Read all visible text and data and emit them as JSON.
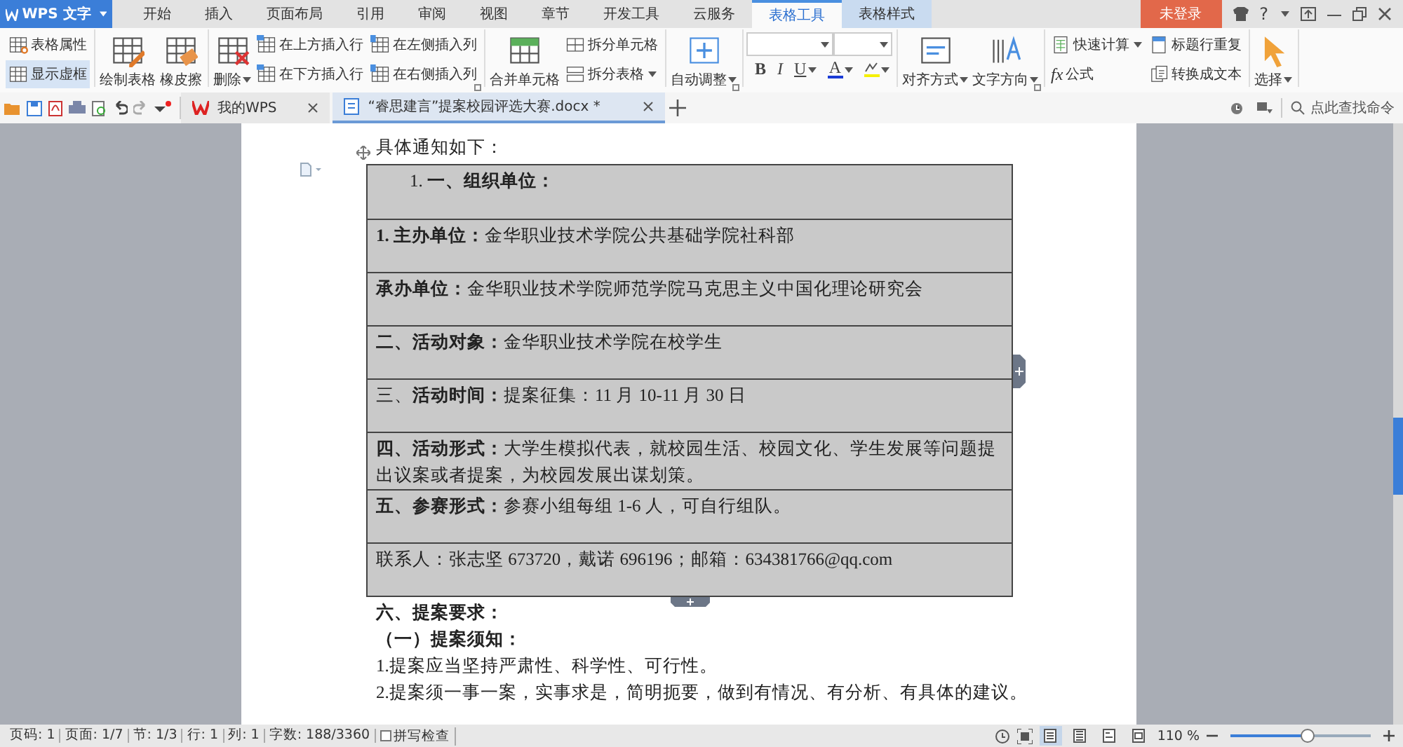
{
  "app_menu": {
    "label": "WPS 文字"
  },
  "menu_tabs": [
    {
      "label": "开始",
      "kind": "main",
      "selected": false
    },
    {
      "label": "插入",
      "kind": "main",
      "selected": false
    },
    {
      "label": "页面布局",
      "kind": "main",
      "selected": false
    },
    {
      "label": "引用",
      "kind": "main",
      "selected": false
    },
    {
      "label": "审阅",
      "kind": "main",
      "selected": false
    },
    {
      "label": "视图",
      "kind": "main",
      "selected": false
    },
    {
      "label": "章节",
      "kind": "main",
      "selected": false
    },
    {
      "label": "开发工具",
      "kind": "main",
      "selected": false
    },
    {
      "label": "云服务",
      "kind": "main",
      "selected": false
    },
    {
      "label": "表格工具",
      "kind": "contextual",
      "selected": true
    },
    {
      "label": "表格样式",
      "kind": "contextual",
      "selected": false
    }
  ],
  "login_button": "未登录",
  "help": "?",
  "ribbon_groups": [
    {
      "kind": "tools",
      "launcher": false,
      "items": [
        {
          "label": "表格属性",
          "kind": "small",
          "dropdown": false,
          "selected": false
        },
        {
          "label": "显示虚框",
          "kind": "small",
          "dropdown": false,
          "selected": true
        }
      ]
    },
    {
      "kind": "tools",
      "launcher": false,
      "items": [
        {
          "label": "绘制表格",
          "kind": "large",
          "dropdown": false
        },
        {
          "label": "橡皮擦",
          "kind": "large",
          "dropdown": false
        }
      ]
    },
    {
      "kind": "tools",
      "launcher": true,
      "items": [
        {
          "label": "删除",
          "kind": "large",
          "dropdown": true
        },
        {
          "label": "在上方插入行",
          "kind": "small",
          "dropdown": false
        },
        {
          "label": "在下方插入行",
          "kind": "small",
          "dropdown": false
        },
        {
          "label": "在左侧插入列",
          "kind": "small",
          "dropdown": false
        },
        {
          "label": "在右侧插入列",
          "kind": "small",
          "dropdown": false
        }
      ]
    },
    {
      "kind": "tools",
      "launcher": false,
      "items": [
        {
          "label": "合并单元格",
          "kind": "large",
          "dropdown": false
        },
        {
          "label": "拆分单元格",
          "kind": "small",
          "dropdown": false
        },
        {
          "label": "拆分表格",
          "kind": "small",
          "dropdown": true
        }
      ]
    },
    {
      "kind": "tools",
      "launcher": true,
      "items": [
        {
          "label": "自动调整",
          "kind": "large",
          "dropdown": true
        }
      ]
    },
    {
      "kind": "font",
      "launcher": false,
      "buttons": [
        {
          "kind": "letter",
          "label": "B",
          "dropdown": false
        },
        {
          "kind": "letter",
          "label": "I",
          "dropdown": false
        },
        {
          "kind": "letter",
          "label": "U",
          "dropdown": true
        },
        {
          "kind": "letter",
          "label": "A",
          "dropdown": true,
          "color": "#1a3bd6"
        },
        {
          "kind": "highlight",
          "dropdown": true,
          "color": "#f5f000"
        }
      ]
    },
    {
      "kind": "tools",
      "launcher": true,
      "items": [
        {
          "label": "对齐方式",
          "kind": "large",
          "dropdown": true
        },
        {
          "label": "文字方向",
          "kind": "large",
          "dropdown": true
        }
      ]
    },
    {
      "kind": "tools",
      "launcher": false,
      "items": [
        {
          "label": "快速计算",
          "kind": "small",
          "dropdown": true
        },
        {
          "label": "标题行重复",
          "kind": "small",
          "dropdown": false
        },
        {
          "label": "公式",
          "kind": "small",
          "dropdown": false,
          "symbol": "fx"
        },
        {
          "label": "转换成文本",
          "kind": "small",
          "dropdown": false
        }
      ]
    },
    {
      "kind": "tools",
      "launcher": false,
      "items": [
        {
          "label": "选择",
          "kind": "large",
          "dropdown": true
        }
      ]
    }
  ],
  "doc_tabs": [
    {
      "label": "我的WPS",
      "kind": "home",
      "selected": false
    },
    {
      "label": "“睿思建言”提案校园评选大赛.docx *",
      "kind": "document",
      "selected": true
    }
  ],
  "command_search": {
    "placeholder": "点此查找命令"
  },
  "document": {
    "intro": "具体通知如下：",
    "table_rows": [
      {
        "kind": "numbered",
        "text": "1.  **一、组织单位：**"
      },
      {
        "kind": "body",
        "text": "**1. 主办单位：**金华职业技术学院公共基础学院社科部"
      },
      {
        "kind": "body",
        "text": "**承办单位：**金华职业技术学院师范学院马克思主义中国化理论研究会"
      },
      {
        "kind": "body",
        "text": "**二、活动对象：**金华职业技术学院在校学生"
      },
      {
        "kind": "body",
        "text": "三、**活动时间：**提案征集：11 月 10-11 月 30 日"
      },
      {
        "kind": "body",
        "text": "**四、活动形式：**大学生模拟代表，就校园生活、校园文化、学生发展等问题提出议案或者提案，为校园发展出谋划策。"
      },
      {
        "kind": "body",
        "text": "**五、参赛形式：**参赛小组每组 1-6 人，可自行组队。"
      },
      {
        "kind": "body",
        "text": "联系人：张志坚 673720，戴诺 696196；邮箱：634381766@qq.com"
      }
    ],
    "paragraphs": [
      {
        "kind": "heading",
        "text": "六、提案要求："
      },
      {
        "kind": "heading",
        "text": "（一）提案须知："
      },
      {
        "kind": "body",
        "text": "1.提案应当坚持严肃性、科学性、可行性。"
      },
      {
        "kind": "body",
        "text": "2.提案须一事一案，实事求是，简明扼要，做到有情况、有分析、有具体的建议。"
      }
    ]
  },
  "status_bar": {
    "items": [
      "页码: 1",
      "页面: 1/7",
      "节: 1/3",
      "行: 1",
      "列: 1",
      "字数: 188/3360"
    ],
    "spell_check": {
      "label": "拼写检查",
      "checked": false
    },
    "view_modes": [
      {
        "selected": true
      },
      {
        "selected": false
      },
      {
        "selected": false
      },
      {
        "selected": false
      }
    ],
    "zoom": {
      "reading": "110 %",
      "level": 0.55
    }
  }
}
